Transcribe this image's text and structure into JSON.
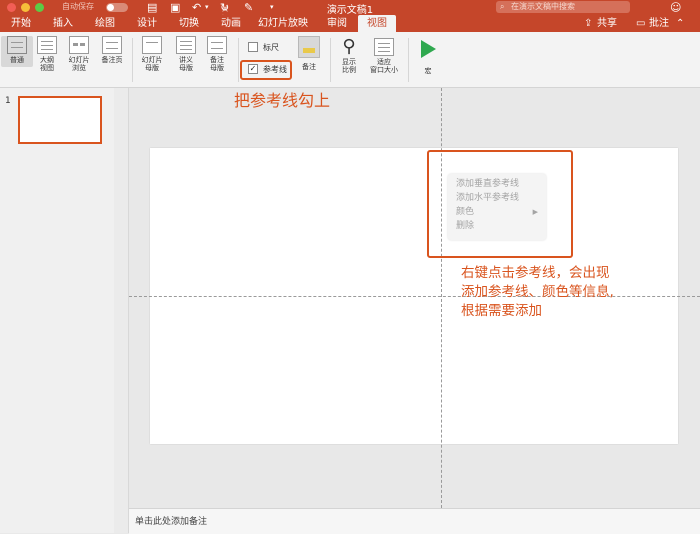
{
  "window": {
    "autosave_label": "自动保存",
    "autosave_state": "关闭",
    "document_title": "演示文稿1",
    "search_placeholder": "在演示文稿中搜索"
  },
  "tabs": [
    {
      "label": "开始"
    },
    {
      "label": "插入"
    },
    {
      "label": "绘图"
    },
    {
      "label": "设计"
    },
    {
      "label": "切换"
    },
    {
      "label": "动画"
    },
    {
      "label": "幻灯片放映"
    },
    {
      "label": "审阅"
    },
    {
      "label": "视图",
      "active": true
    }
  ],
  "tab_actions": {
    "share": "共享",
    "comments": "批注"
  },
  "ribbon": {
    "normal": "普通",
    "outline_view": [
      "大纲",
      "视图"
    ],
    "slide_sorter": [
      "幻灯片",
      "浏览"
    ],
    "notes_page": "备注页",
    "slide_master": [
      "幻灯片",
      "母版"
    ],
    "handout_master": [
      "讲义",
      "母版"
    ],
    "notes_master": [
      "备注",
      "母版"
    ],
    "ruler": "标尺",
    "ruler_checked": false,
    "guides": "参考线",
    "guides_checked": true,
    "notes": "备注",
    "zoom": [
      "显示",
      "比例"
    ],
    "fit_to_window": [
      "适应",
      "窗口大小"
    ],
    "macros": "宏"
  },
  "thumbnail": {
    "number": "1"
  },
  "context_menu": {
    "items": [
      "添加垂直参考线",
      "添加水平参考线",
      "颜色",
      "删除"
    ]
  },
  "annotations": {
    "check_guides": "把参考线勾上",
    "right_click_lines": [
      "右键点击参考线，会出现",
      "添加参考线、颜色等信息,",
      "根据需要添加"
    ]
  },
  "notes_placeholder": "单击此处添加备注",
  "colors": {
    "accent": "#c5462a",
    "annotation": "#d9541e",
    "macro_green": "#2fa84f"
  }
}
